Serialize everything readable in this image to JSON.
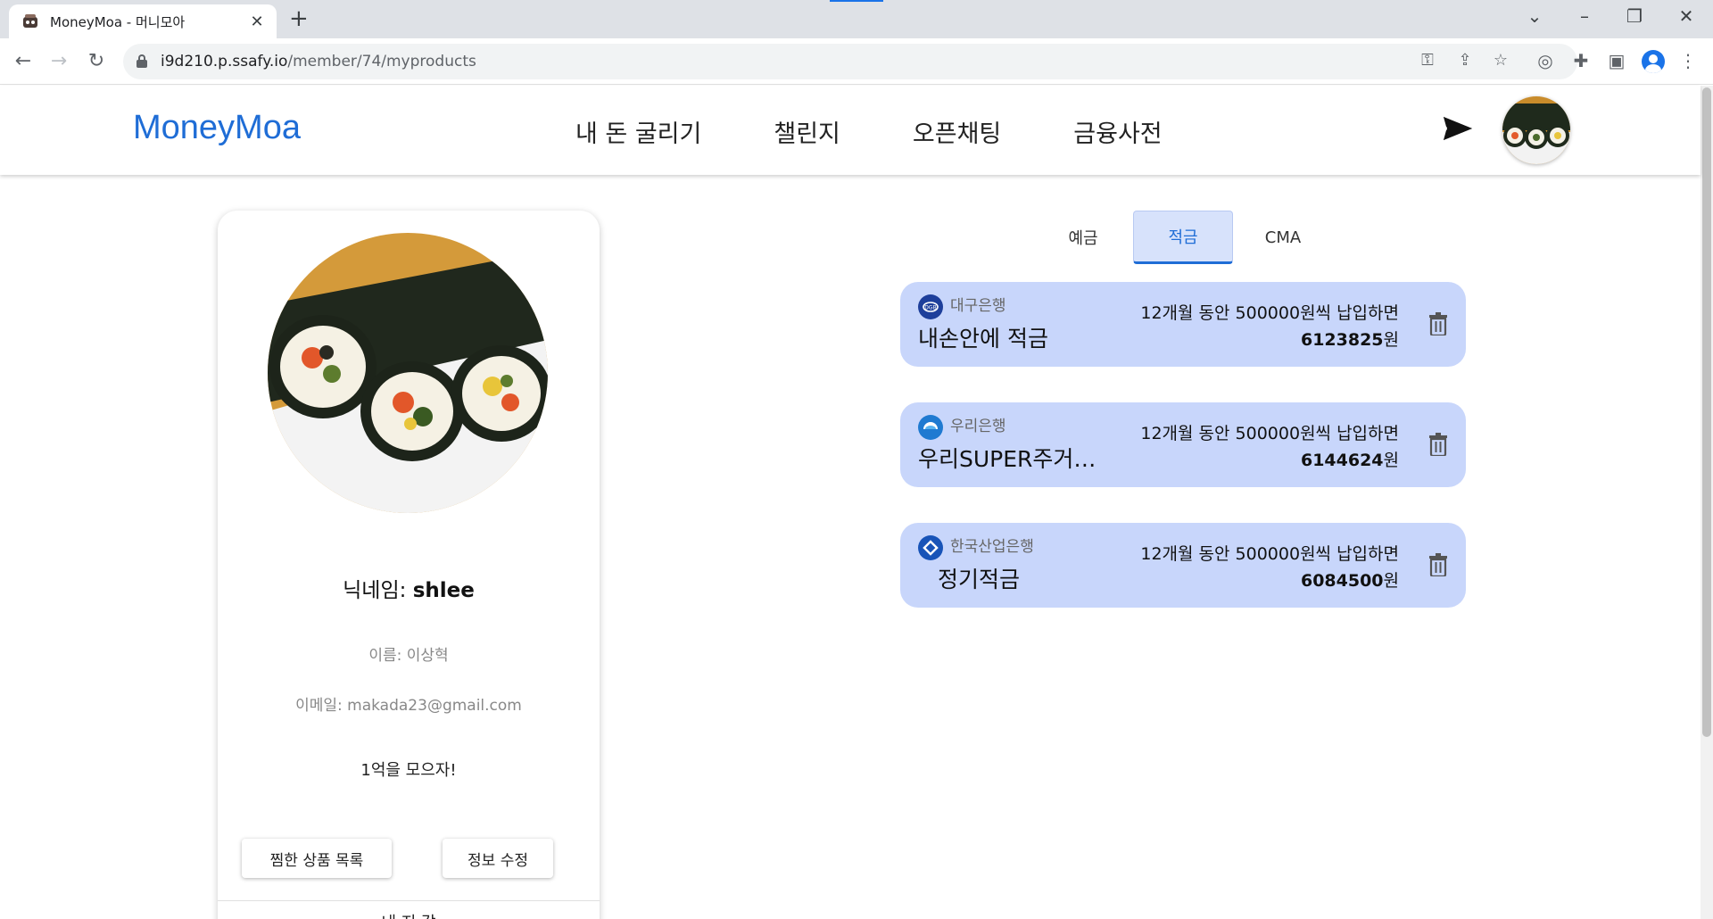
{
  "browser": {
    "tab_title": "MoneyMoa - 머니모아",
    "url_host": "i9d210.p.ssafy.io",
    "url_path": "/member/74/myproducts"
  },
  "header": {
    "logo": "MoneyMoa",
    "nav": [
      "내 돈 굴리기",
      "챌린지",
      "오픈채팅",
      "금융사전"
    ]
  },
  "profile": {
    "nickname_label": "닉네임: ",
    "nickname": "shlee",
    "name_line": "이름: 이상혁",
    "email_line": "이메일: makada23@gmail.com",
    "motto": "1억을 모으자!",
    "wishlist_button": "찜한 상품 목록",
    "edit_button": "정보 수정",
    "more_section": "내 지 갑"
  },
  "tabs": [
    "예금",
    "적금",
    "CMA"
  ],
  "active_tab": "적금",
  "products": [
    {
      "bank": "대구은행",
      "name": "내손안에 적금",
      "terms": "12개월 동안 500000원씩 납입하면",
      "amount": "6123825",
      "unit": "원",
      "bank_color": "#1e3f9b"
    },
    {
      "bank": "우리은행",
      "name": "우리SUPER주거래적금",
      "terms": "12개월 동안 500000원씩 납입하면",
      "amount": "6144624",
      "unit": "원",
      "bank_color": "#1f7ad1"
    },
    {
      "bank": "한국산업은행",
      "name": "정기적금",
      "terms": "12개월 동안 500000원씩 납입하면",
      "amount": "6084500",
      "unit": "원",
      "bank_color": "#1854b8"
    }
  ],
  "icons": {
    "send": "send-icon",
    "delete": "trash-icon",
    "lock": "lock-icon"
  },
  "colors": {
    "brand": "#1f6dd6",
    "card_bg": "#c8d6fb",
    "active_tab_bg": "#d7e2fb"
  }
}
